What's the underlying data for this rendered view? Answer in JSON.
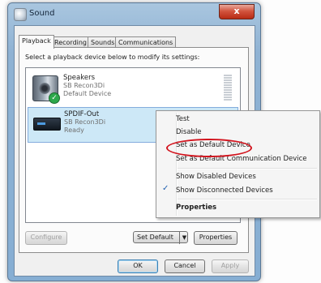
{
  "window": {
    "title": "Sound",
    "close_glyph": "x"
  },
  "tabs": [
    {
      "label": "Playback",
      "active": true
    },
    {
      "label": "Recording",
      "active": false
    },
    {
      "label": "Sounds",
      "active": false
    },
    {
      "label": "Communications",
      "active": false
    }
  ],
  "playback": {
    "instruction": "Select a playback device below to modify its settings:",
    "devices": [
      {
        "name": "Speakers",
        "driver": "SB Recon3Di",
        "status": "Default Device",
        "icon": "speaker-icon",
        "default": true
      },
      {
        "name": "SPDIF-Out",
        "driver": "SB Recon3Di",
        "status": "Ready",
        "icon": "spdif-device-icon",
        "selected": true
      }
    ]
  },
  "buttons": {
    "configure": "Configure",
    "set_default": "Set Default",
    "properties": "Properties",
    "ok": "OK",
    "cancel": "Cancel",
    "apply": "Apply"
  },
  "context_menu": {
    "items": [
      {
        "label": "Test"
      },
      {
        "label": "Disable"
      },
      {
        "label": "Set as Default Device",
        "highlighted_by_annotation": true
      },
      {
        "label": "Set as Default Communication Device"
      },
      {
        "label": "Show Disabled Devices",
        "checked": false
      },
      {
        "label": "Show Disconnected Devices",
        "checked": true
      },
      {
        "label": "Properties",
        "bold": true
      }
    ],
    "check_glyph": "✓"
  },
  "colors": {
    "annotation_circle": "#d2141e",
    "selection": "#cde8f7",
    "window_frame": "#8fb2d3"
  }
}
